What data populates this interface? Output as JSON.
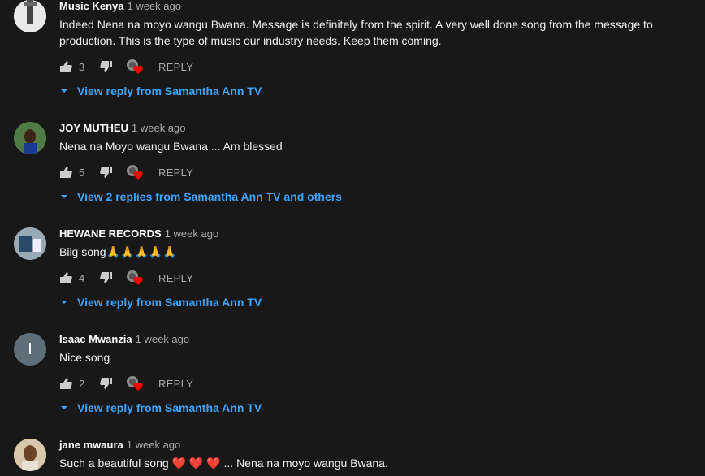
{
  "reply_label": "REPLY",
  "comments": [
    {
      "author": "Music Kenya",
      "time": "1 week ago",
      "text": "Indeed Nena na moyo wangu Bwana. Message is definitely from the spirit. A very well done song from the message to production. This is the type of music our industry needs. Keep them coming.",
      "likes": "3",
      "replies_link": "View reply from Samantha Ann TV"
    },
    {
      "author": "JOY MUTHEU",
      "time": "1 week ago",
      "text": "Nena na Moyo wangu Bwana ... Am blessed",
      "likes": "5",
      "replies_link": "View 2 replies from Samantha Ann TV and others"
    },
    {
      "author": "HEWANE RECORDS",
      "time": "1 week ago",
      "text": "Biig song🙏🙏🙏🙏🙏",
      "likes": "4",
      "replies_link": "View reply from Samantha Ann TV"
    },
    {
      "author": "Isaac Mwanzia",
      "time": "1 week ago",
      "avatar_letter": "I",
      "text": "Nice song",
      "likes": "2",
      "replies_link": "View reply from Samantha Ann TV"
    },
    {
      "author": "jane mwaura",
      "time": "1 week ago",
      "text": "Such a beautiful song ❤️ ❤️ ❤️ ... Nena na moyo wangu Bwana."
    }
  ],
  "colors": {
    "background": "#181818",
    "link": "#3ea6ff",
    "muted": "#aaaaaa",
    "heart": "#ff0000"
  }
}
